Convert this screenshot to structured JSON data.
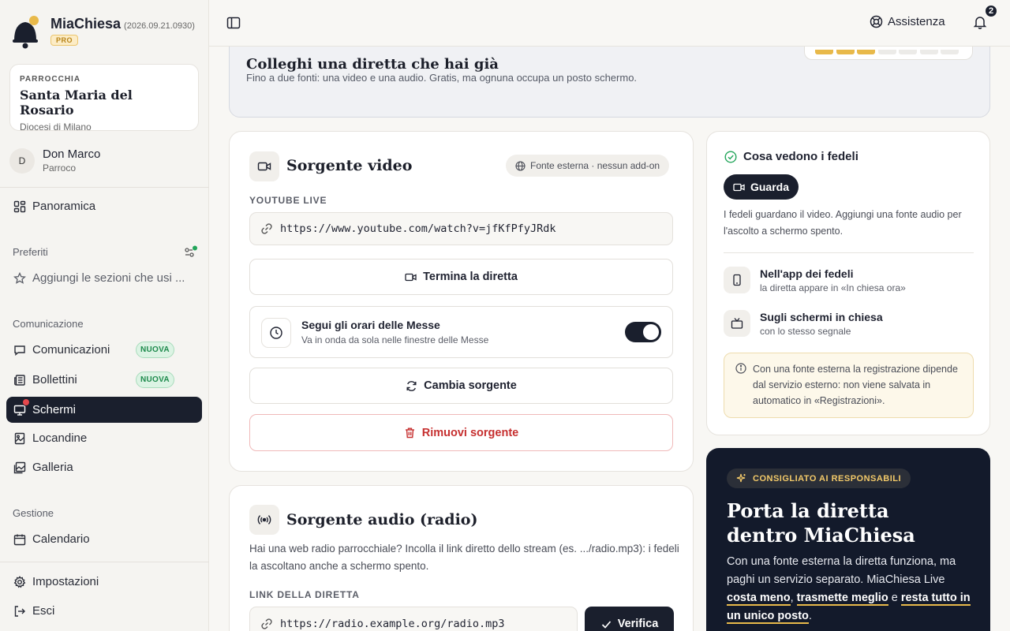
{
  "app": {
    "name": "MiaChiesa",
    "version": "(2026.09.21.0930)",
    "plan_badge": "PRO"
  },
  "parish": {
    "kicker": "PARROCCHIA",
    "name": "Santa Maria del Rosario",
    "diocese": "Diocesi di Milano"
  },
  "user": {
    "initial": "D",
    "name": "Don Marco",
    "role": "Parroco"
  },
  "sidebar": {
    "overview": "Panoramica",
    "favorites_section": "Preferiti",
    "favorites_hint": "Aggiungi le sezioni che usi ...",
    "communication_section": "Comunicazione",
    "items_communication": [
      {
        "label": "Comunicazioni",
        "badge": "NUOVA"
      },
      {
        "label": "Bollettini",
        "badge": "NUOVA"
      },
      {
        "label": "Schermi",
        "active": true
      },
      {
        "label": "Locandine"
      },
      {
        "label": "Galleria"
      }
    ],
    "management_section": "Gestione",
    "calendar": "Calendario",
    "settings": "Impostazioni",
    "logout": "Esci"
  },
  "topbar": {
    "help": "Assistenza",
    "notifications_count": "2"
  },
  "banner": {
    "title": "Colleghi una diretta che hai già",
    "subtitle": "Fino a due fonti: una video e una audio. Gratis, ma ognuna occupa un posto schermo.",
    "slots_used": 3,
    "slots_total": 7
  },
  "video_source": {
    "title": "Sorgente video",
    "chip": "Fonte esterna · nessun add-on",
    "field_label": "YOUTUBE LIVE",
    "url": "https://www.youtube.com/watch?v=jfKfPfyJRdk",
    "end_button": "Termina la diretta",
    "schedule_title": "Segui gli orari delle Messe",
    "schedule_sub": "Va in onda da sola nelle finestre delle Messe",
    "schedule_enabled": true,
    "change_button": "Cambia sorgente",
    "remove_button": "Rimuovi sorgente"
  },
  "audio_source": {
    "title": "Sorgente audio (radio)",
    "description": "Hai una web radio parrocchiale? Incolla il link diretto dello stream (es. .../radio.mp3): i fedeli la ascoltano anche a schermo spento.",
    "field_label": "LINK DELLA DIRETTA",
    "url": "https://radio.example.org/radio.mp3",
    "verify_button": "Verifica"
  },
  "preview": {
    "title": "Cosa vedono i fedeli",
    "watch_button": "Guarda",
    "description": "I fedeli guardano il video. Aggiungi una fonte audio per l'ascolto a schermo spento.",
    "features": [
      {
        "title": "Nell'app dei fedeli",
        "sub": "la diretta appare in «In chiesa ora»"
      },
      {
        "title": "Sugli schermi in chiesa",
        "sub": "con lo stesso segnale"
      }
    ],
    "warning": "Con una fonte esterna la registrazione dipende dal servizio esterno: non viene salvata in automatico in «Registrazioni»."
  },
  "promo": {
    "chip": "CONSIGLIATO AI RESPONSABILI",
    "title": "Porta la diretta dentro MiaChiesa",
    "body_intro": "Con una fonte esterna la diretta funziona, ma paghi un servizio separato. MiaChiesa Live",
    "hl1": "costa meno",
    "sep1": ",",
    "hl2": "trasmette meglio",
    "sep2": "e",
    "hl3": "resta tutto in un unico posto",
    "end": "."
  },
  "colors": {
    "accent_dark": "#1a1f2d",
    "slot_filled": "#e8b94a",
    "slot_empty": "#ecebe8",
    "danger": "#c62f2f",
    "success": "#22a55a"
  }
}
